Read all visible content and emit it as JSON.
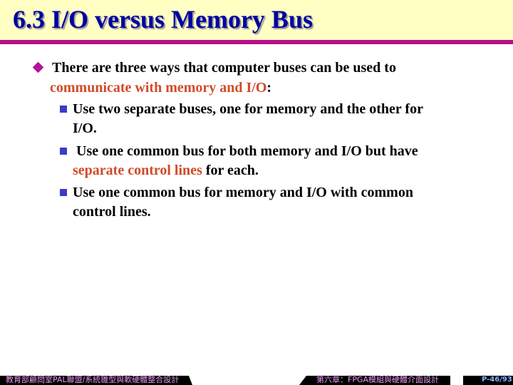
{
  "title": "6.3 I/O versus Memory Bus",
  "colors": {
    "title_text": "#0000A0",
    "title_band": "#FFFFC4",
    "rule": "#B5108A",
    "highlight": "#D04A28",
    "sub_bullet": "#3C3CC8"
  },
  "main": {
    "bullet_icon": "diamond-icon",
    "line1": "There are three ways that computer buses can be used to",
    "line2_highlight": "communicate with memory and I/O",
    "line2_rest": ":",
    "items": [
      {
        "bullet_icon": "square-icon",
        "line1": "Use two separate buses, one for memory and the other for",
        "line2": "I/O."
      },
      {
        "bullet_icon": "square-icon",
        "line1": " Use one common bus for both memory and I/O but have",
        "line2_highlight": "separate control lines",
        "line2_rest": " for each."
      },
      {
        "bullet_icon": "square-icon",
        "line1": "Use one common bus for memory and I/O with common",
        "line2": "control lines."
      }
    ]
  },
  "footer": {
    "left": "教育部顧問室PAL聯盟/系統雛型與軟硬體整合設計",
    "center": "第六章：FPGA模組與硬體介面設計",
    "page": "P-46/93"
  }
}
